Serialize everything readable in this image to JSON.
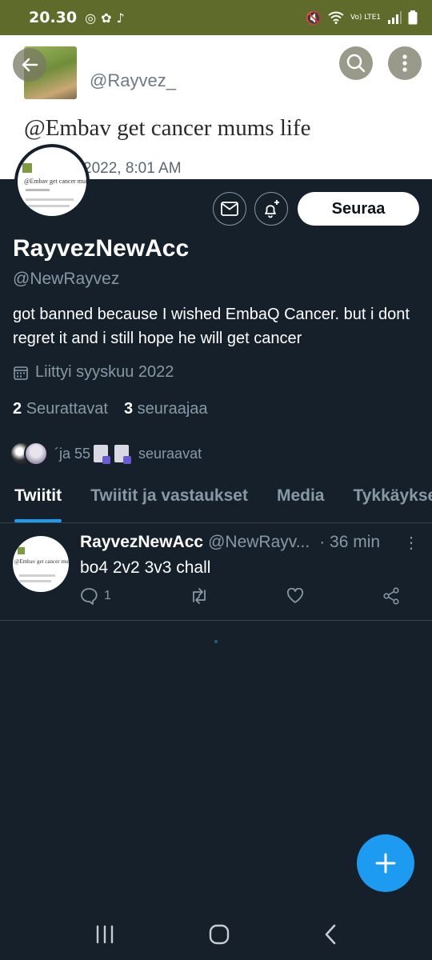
{
  "status_bar": {
    "time": "20.30",
    "network": "Vo) LTE1"
  },
  "banner": {
    "emoji": "😋",
    "handle": "@Rayvez_",
    "tweet": "@Embav get cancer mums life",
    "date": "2022, 8:01 AM"
  },
  "mini_tweet": {
    "text": "@Embav get cancer mums life"
  },
  "profile": {
    "display_name": "RayvezNewAcc",
    "username": "@NewRayvez",
    "bio": "got banned because I wished EmbaQ Cancer. but i dont regret it and i still hope he will get cancer",
    "joined": "Liittyi syyskuu 2022",
    "following_count": "2",
    "following_label": "Seurattavat",
    "followers_count": "3",
    "followers_label": "seuraajaa",
    "followed_by_text": "´ja 55",
    "followed_by_suffix": "seuraavat",
    "follow_button": "Seuraa"
  },
  "tabs": [
    "Twiitit",
    "Twiitit ja vastaukset",
    "Media",
    "Tykkäykset"
  ],
  "tweet": {
    "name": "RayvezNewAcc",
    "handle": "@NewRayv...",
    "time": "· 36 min",
    "text": "bo4 2v2 3v3 chall",
    "reply_count": "1"
  },
  "colors": {
    "accent": "#1d9bf0",
    "background": "#15202b",
    "status_bar": "#5f6b2a"
  }
}
